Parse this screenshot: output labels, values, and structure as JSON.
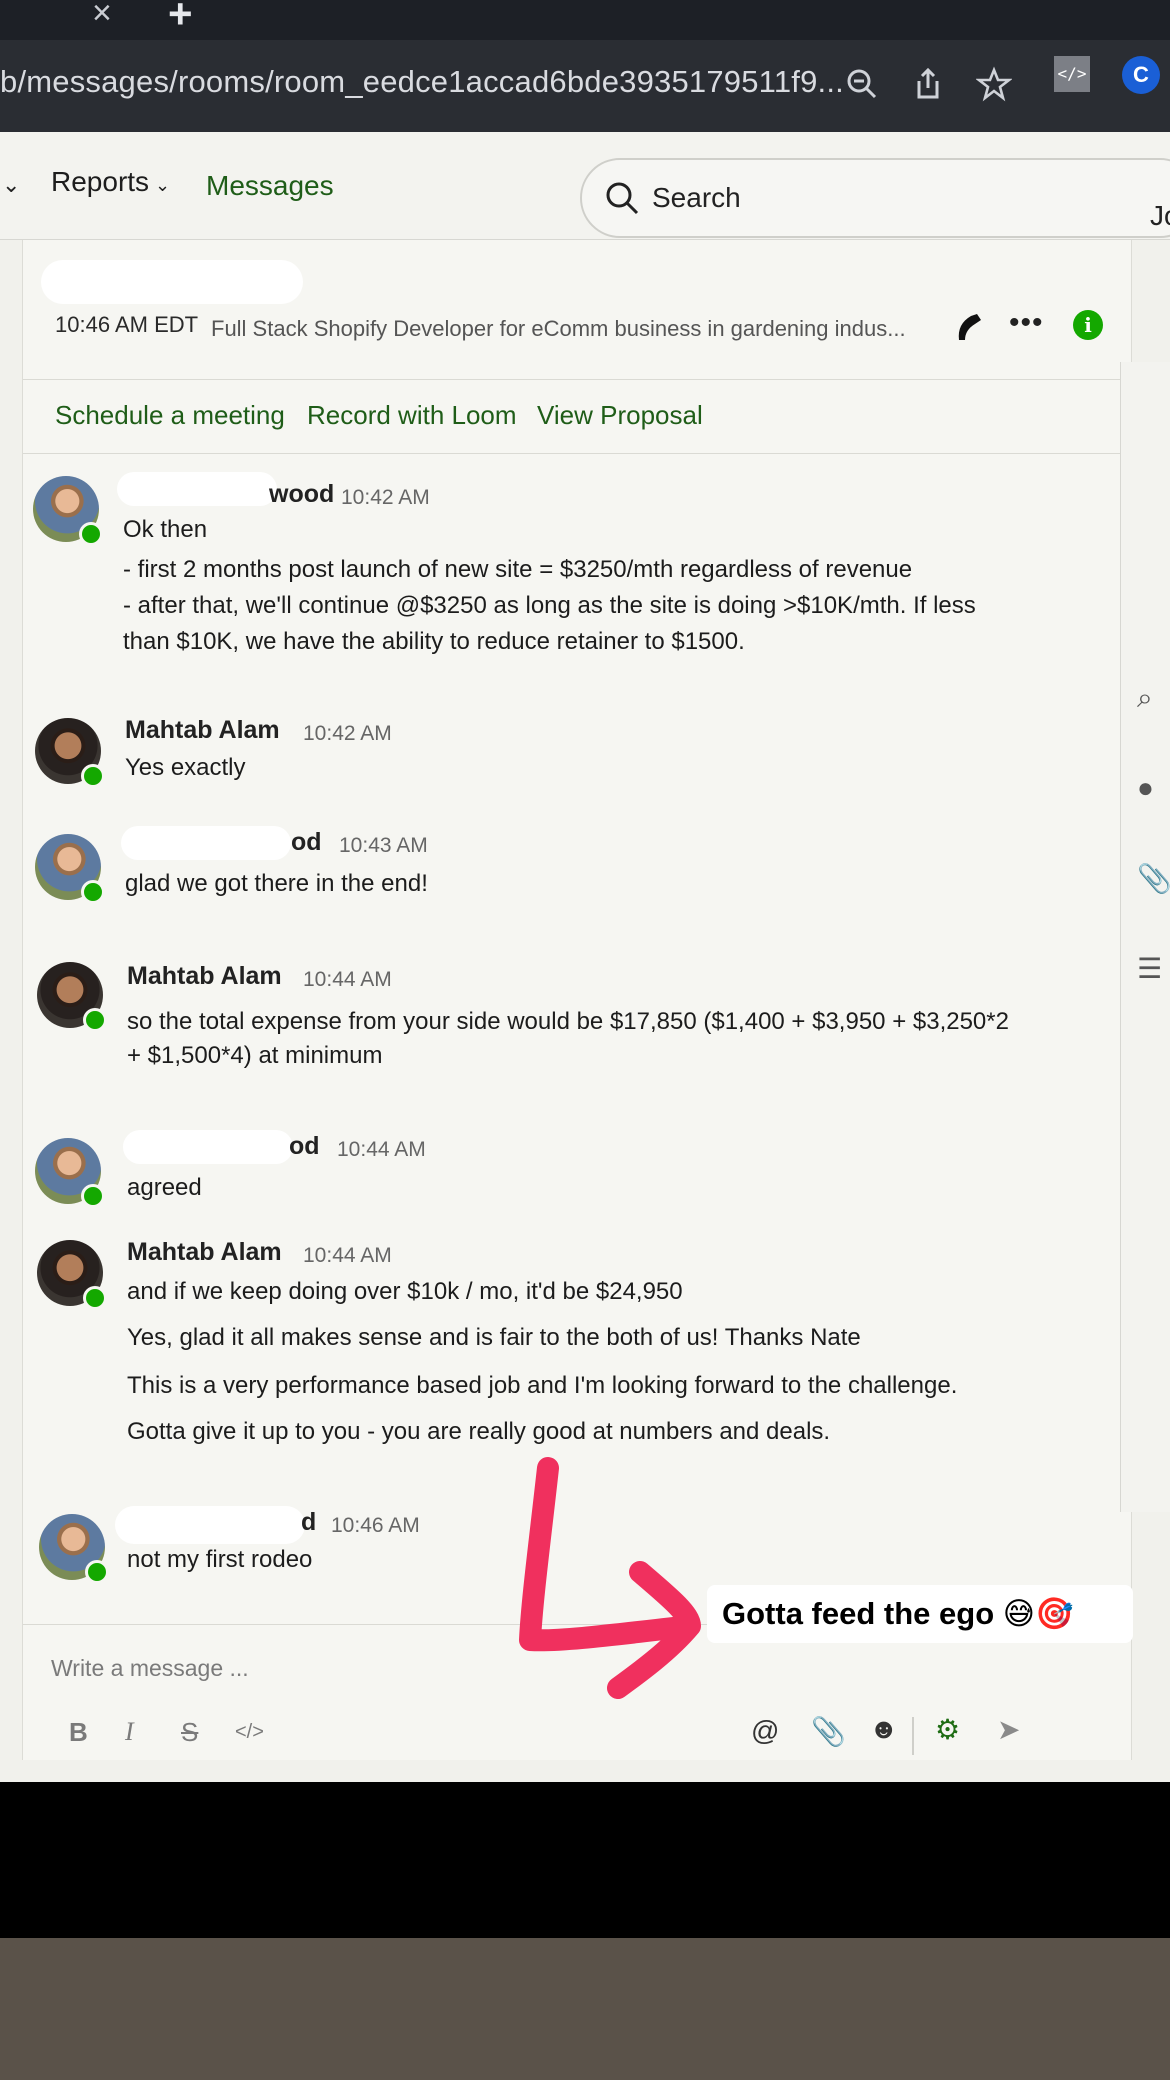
{
  "browser": {
    "url": "b/messages/rooms/room_eedce1accad6bde3935179511f9...",
    "icons": [
      "zoom-out-icon",
      "share-icon",
      "bookmark-star-icon",
      "code-extension-icon",
      "profile-extension-icon"
    ]
  },
  "nav": {
    "reports_label": "Reports",
    "messages_label": "Messages",
    "search_label": "Search",
    "user_initials": "Jo"
  },
  "room": {
    "time": "10:46 AM EDT",
    "title": "Full Stack Shopify Developer for eComm business in gardening indus...",
    "actions": {
      "schedule": "Schedule a meeting",
      "loom": "Record with Loom",
      "proposal": "View Proposal"
    }
  },
  "messages": [
    {
      "sender": "wood",
      "time": "10:42 AM",
      "lines": [
        "Ok then",
        "- first 2 months post launch of new site = $3250/mth regardless of revenue",
        "- after that, we'll continue @$3250 as long as the site is doing >$10K/mth. If less",
        "than $10K, we have the ability to reduce retainer to $1500."
      ]
    },
    {
      "sender": "Mahtab Alam",
      "time": "10:42 AM",
      "lines": [
        "Yes exactly"
      ]
    },
    {
      "sender": "od",
      "time": "10:43 AM",
      "lines": [
        "glad we got there in the end!"
      ]
    },
    {
      "sender": "Mahtab Alam",
      "time": "10:44 AM",
      "lines": [
        "so the total expense from your side would be $17,850 ($1,400 + $3,950 + $3,250*2",
        "+ $1,500*4) at minimum"
      ]
    },
    {
      "sender": "od",
      "time": "10:44 AM",
      "lines": [
        "agreed"
      ]
    },
    {
      "sender": "Mahtab Alam",
      "time": "10:44 AM",
      "lines": [
        "and if we keep doing over $10k / mo, it'd be $24,950",
        "Yes, glad it all makes sense and is fair to the both of us! Thanks Nate",
        "This is a very performance based job and I'm looking forward to the challenge.",
        "Gotta give it up to you - you are really good at numbers and deals."
      ]
    },
    {
      "sender": "d",
      "time": "10:46 AM",
      "lines": [
        "not my first rodeo"
      ]
    }
  ],
  "composer": {
    "placeholder": "Write a message ...",
    "format_buttons": [
      "B",
      "I",
      "S",
      "</>"
    ]
  },
  "overlay": {
    "caption": "Gotta feed the ego 😅🎯",
    "arrow_color": "#f0305e"
  },
  "colors": {
    "brand_green": "#14a800",
    "link_green": "#1f5d18"
  }
}
